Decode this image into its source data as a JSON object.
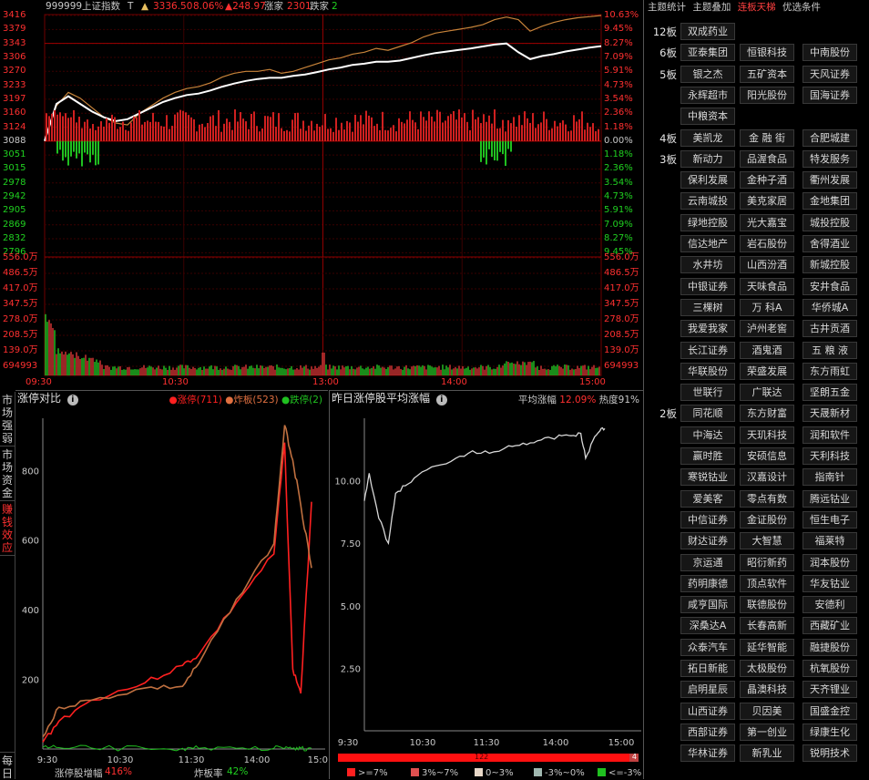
{
  "header": {
    "code": "999999",
    "name": "上证指数",
    "mark": "T",
    "price": "3336.50",
    "pct": "8.06%",
    "change": "▲248.97",
    "up_label": "涨家",
    "up_count": "2301",
    "down_label": "跌家",
    "down_count": "2"
  },
  "price_axis": {
    "left": [
      "3416",
      "3379",
      "3343",
      "3306",
      "3270",
      "3233",
      "3197",
      "3160",
      "3124",
      "3088",
      "3051",
      "3015",
      "2978",
      "2942",
      "2905",
      "2869",
      "2832",
      "2796"
    ],
    "right": [
      "10.63%",
      "9.45%",
      "8.27%",
      "7.09%",
      "5.91%",
      "4.73%",
      "3.54%",
      "2.36%",
      "1.18%",
      "0.00%",
      "1.18%",
      "2.36%",
      "3.54%",
      "4.73%",
      "5.91%",
      "7.09%",
      "8.27%",
      "9.45%"
    ]
  },
  "vol_axis": [
    "556.0万",
    "486.5万",
    "417.0万",
    "347.5万",
    "278.0万",
    "208.5万",
    "139.0万",
    "694993"
  ],
  "time_axis": [
    "09:30",
    "10:30",
    "13:00",
    "14:00",
    "15:00"
  ],
  "colors": {
    "up": "#e33",
    "down": "#0c0",
    "ref": "#c00000",
    "grid": "#3a0000",
    "price": "#ffffff",
    "avg": "#c8843a"
  },
  "menu": {
    "items": [
      "主题统计",
      "主题叠加",
      "连板天梯",
      "优选条件"
    ],
    "active": 2
  },
  "ladder": [
    {
      "level": "12板",
      "stocks": [
        "双成药业"
      ]
    },
    {
      "level": "6板",
      "stocks": [
        "亚泰集团",
        "恒银科技",
        "中南股份"
      ]
    },
    {
      "level": "5板",
      "stocks": [
        "银之杰",
        "五矿资本",
        "天风证券",
        "永辉超市",
        "阳光股份",
        "国海证券",
        "中粮资本"
      ]
    },
    {
      "level": "4板",
      "stocks": [
        "美凯龙",
        "金 融 街",
        "合肥城建"
      ]
    },
    {
      "level": "3板",
      "stocks": [
        "新动力",
        "品渥食品",
        "特发服务",
        "保利发展",
        "金种子酒",
        "衢州发展",
        "云南城投",
        "美克家居",
        "金地集团",
        "绿地控股",
        "光大嘉宝",
        "城投控股",
        "信达地产",
        "岩石股份",
        "舍得酒业",
        "水井坊",
        "山西汾酒",
        "新城控股",
        "中银证券",
        "天味食品",
        "安井食品",
        "三棵树",
        "万 科A",
        "华侨城A",
        "我爱我家",
        "泸州老窖",
        "古井贡酒",
        "长江证券",
        "酒鬼酒",
        "五 粮 液",
        "华联股份",
        "荣盛发展",
        "东方雨虹",
        "世联行",
        "广联达",
        "坚朗五金"
      ]
    },
    {
      "level": "2板",
      "stocks": [
        "同花顺",
        "东方财富",
        "天晟新材",
        "中海达",
        "天玑科技",
        "润和软件",
        "赢时胜",
        "安硕信息",
        "天利科技",
        "寒锐钴业",
        "汉嘉设计",
        "指南针",
        "爱美客",
        "零点有数",
        "腾远钴业",
        "中信证券",
        "金证股份",
        "恒生电子",
        "财达证券",
        "大智慧",
        "福莱特",
        "京运通",
        "昭衍新药",
        "润本股份",
        "药明康德",
        "顶点软件",
        "华友钴业",
        "咸亨国际",
        "联德股份",
        "安德利",
        "深桑达A",
        "长春高新",
        "西藏矿业",
        "众泰汽车",
        "延华智能",
        "融捷股份",
        "拓日新能",
        "太极股份",
        "杭氧股份",
        "启明星辰",
        "晶澳科技",
        "天齐锂业",
        "山西证券",
        "贝因美",
        "国盛金控",
        "西部证券",
        "第一创业",
        "绿康生化",
        "华林证券",
        "新乳业",
        "锐明技术"
      ]
    }
  ],
  "side_tabs": [
    "市场强弱",
    "市场资金",
    "赚钱效应",
    "每日"
  ],
  "panel_left": {
    "title": "涨停对比",
    "legend": [
      {
        "label": "涨停(711)",
        "color": "#ff2020"
      },
      {
        "label": "炸板(523)",
        "color": "#e07040"
      },
      {
        "label": "跌停(2)",
        "color": "#20c020"
      }
    ],
    "y_labels": [
      "800",
      "600",
      "400",
      "200"
    ],
    "x_labels": [
      "9:30",
      "10:30",
      "11:30",
      "14:00",
      "15:00"
    ],
    "footer_left_label": "涨停股增幅",
    "footer_left_value": "416%",
    "footer_right_label": "炸板率",
    "footer_right_value": "42%"
  },
  "panel_right": {
    "title": "昨日涨停股平均涨幅",
    "avg_label": "平均涨幅",
    "avg_value": "12.09%",
    "heat_label": "热度",
    "heat_value": "91%",
    "y_labels": [
      "10.00",
      "7.50",
      "5.00",
      "2.50"
    ],
    "x_labels": [
      "9:30",
      "10:30",
      "11:30",
      "14:00",
      "15:00"
    ],
    "bar_count": "122",
    "bar_small": "4",
    "legend": [
      {
        "label": ">=7%",
        "color": "#ff2020"
      },
      {
        "label": "3%~7%",
        "color": "#e05050"
      },
      {
        "label": "0~3%",
        "color": "#e8d8c8"
      },
      {
        "label": "-3%~0%",
        "color": "#a0b8b0"
      },
      {
        "label": "<=-3%",
        "color": "#20c020"
      }
    ]
  },
  "chart_data": [
    {
      "type": "line",
      "title": "",
      "series": [
        {
          "values": [
            3088,
            3180,
            3215,
            3200,
            3175,
            3150,
            3135,
            3130,
            3160,
            3180,
            3200,
            3215,
            3225,
            3230,
            3240,
            3255,
            3265,
            3270,
            3270,
            3275,
            3265,
            3270,
            3280,
            3290,
            3300,
            3305,
            3315,
            3320,
            3330,
            3325,
            3335,
            3345,
            3360,
            3370,
            3375,
            3380,
            3385,
            3392,
            3405,
            3412,
            3405,
            3375,
            3388,
            3398,
            3405,
            3410,
            3413,
            3416
          ]
        },
        {
          "values": [
            3088,
            3185,
            3205,
            3185,
            3165,
            3150,
            3140,
            3145,
            3160,
            3175,
            3190,
            3200,
            3208,
            3212,
            3220,
            3230,
            3238,
            3245,
            3250,
            3253,
            3253,
            3258,
            3262,
            3268,
            3275,
            3280,
            3287,
            3290,
            3295,
            3295,
            3298,
            3305,
            3312,
            3318,
            3322,
            3326,
            3330,
            3335,
            3340,
            3343,
            3320,
            3302,
            3310,
            3315,
            3322,
            3327,
            3332,
            3336
          ]
        }
      ],
      "ylim": [
        2796,
        3416
      ]
    },
    {
      "type": "line",
      "title": "涨停对比",
      "x": [
        "9:30",
        "10:30",
        "11:30",
        "14:00",
        "15:00"
      ],
      "series": [
        {
          "name": "涨停(711)",
          "values": [
            20,
            80,
            140,
            190,
            240,
            270,
            420,
            560,
            880,
            230,
            160,
            710
          ]
        },
        {
          "name": "炸板(523)",
          "values": [
            35,
            120,
            140,
            175,
            180,
            245,
            430,
            590,
            930,
            830,
            700,
            520
          ]
        },
        {
          "name": "跌停(2)",
          "values": [
            5,
            4,
            3,
            2,
            2,
            2,
            2,
            2,
            2,
            2,
            2,
            2
          ]
        }
      ],
      "ylim": [
        0,
        950
      ]
    },
    {
      "type": "line",
      "title": "昨日涨停股平均涨幅",
      "x": [
        "9:30",
        "10:30",
        "11:30",
        "14:00",
        "15:00"
      ],
      "series": [
        {
          "values": [
            9.2,
            10.3,
            8.5,
            7.5,
            9.5,
            9.8,
            10.2,
            10.6,
            10.9,
            11.2,
            11.1,
            11.4,
            11.5,
            11.6,
            11.7,
            11.8,
            11.8,
            11.9,
            10.9,
            11.6,
            12.0,
            12.09
          ]
        }
      ],
      "ylim": [
        0,
        12.5
      ]
    }
  ]
}
